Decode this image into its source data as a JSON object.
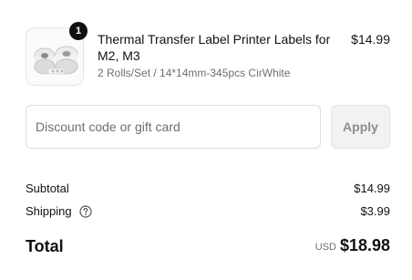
{
  "product": {
    "quantity": "1",
    "title": "Thermal Transfer Label Printer Labels for M2, M3",
    "variant": "2 Rolls/Set / 14*14mm-345pcs CirWhite",
    "price": "$14.99",
    "image_icon": "label-rolls-thumbnail"
  },
  "discount": {
    "placeholder": "Discount code or gift card",
    "value": "",
    "apply_label": "Apply"
  },
  "summary": {
    "subtotal_label": "Subtotal",
    "subtotal_value": "$14.99",
    "shipping_label": "Shipping",
    "shipping_help_icon": "question-circle-icon",
    "shipping_value": "$3.99",
    "total_label": "Total",
    "currency": "USD",
    "total_value": "$18.98"
  },
  "colors": {
    "text": "#111111",
    "muted": "#707070",
    "badge": "#111111",
    "button_bg": "#f2f2f2",
    "button_text": "#8c8c8c",
    "border": "#dedede"
  }
}
